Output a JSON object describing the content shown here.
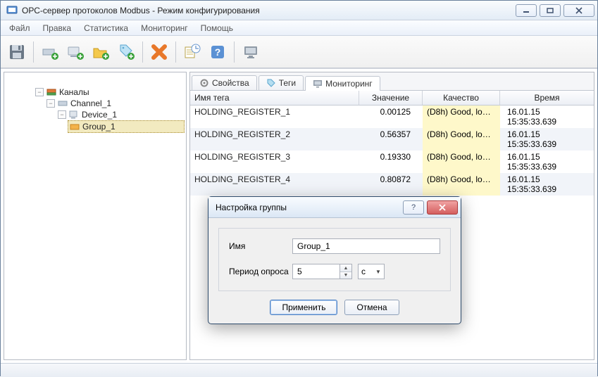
{
  "window": {
    "title": "ОРС-сервер протоколов Modbus - Режим конфигурирования"
  },
  "menus": [
    "Файл",
    "Правка",
    "Статистика",
    "Мониторинг",
    "Помощь"
  ],
  "tree": {
    "root": "Каналы",
    "channel": "Channel_1",
    "device": "Device_1",
    "group": "Group_1"
  },
  "tabs": {
    "properties": "Свойства",
    "tags": "Теги",
    "monitoring": "Мониторинг"
  },
  "columns": {
    "name": "Имя тега",
    "value": "Значение",
    "quality": "Качество",
    "time": "Время"
  },
  "rows": [
    {
      "name": "HOLDING_REGISTER_1",
      "value": "0.00125",
      "quality": "(D8h) Good, lo…",
      "time": "16.01.15 15:35:33.639"
    },
    {
      "name": "HOLDING_REGISTER_2",
      "value": "0.56357",
      "quality": "(D8h) Good, lo…",
      "time": "16.01.15 15:35:33.639"
    },
    {
      "name": "HOLDING_REGISTER_3",
      "value": "0.19330",
      "quality": "(D8h) Good, lo…",
      "time": "16.01.15 15:35:33.639"
    },
    {
      "name": "HOLDING_REGISTER_4",
      "value": "0.80872",
      "quality": "(D8h) Good, lo…",
      "time": "16.01.15 15:35:33.639"
    }
  ],
  "dialog": {
    "title": "Настройка группы",
    "name_label": "Имя",
    "name_value": "Group_1",
    "period_label": "Период опроса",
    "period_value": "5",
    "unit": "с",
    "apply": "Применить",
    "cancel": "Отмена"
  }
}
